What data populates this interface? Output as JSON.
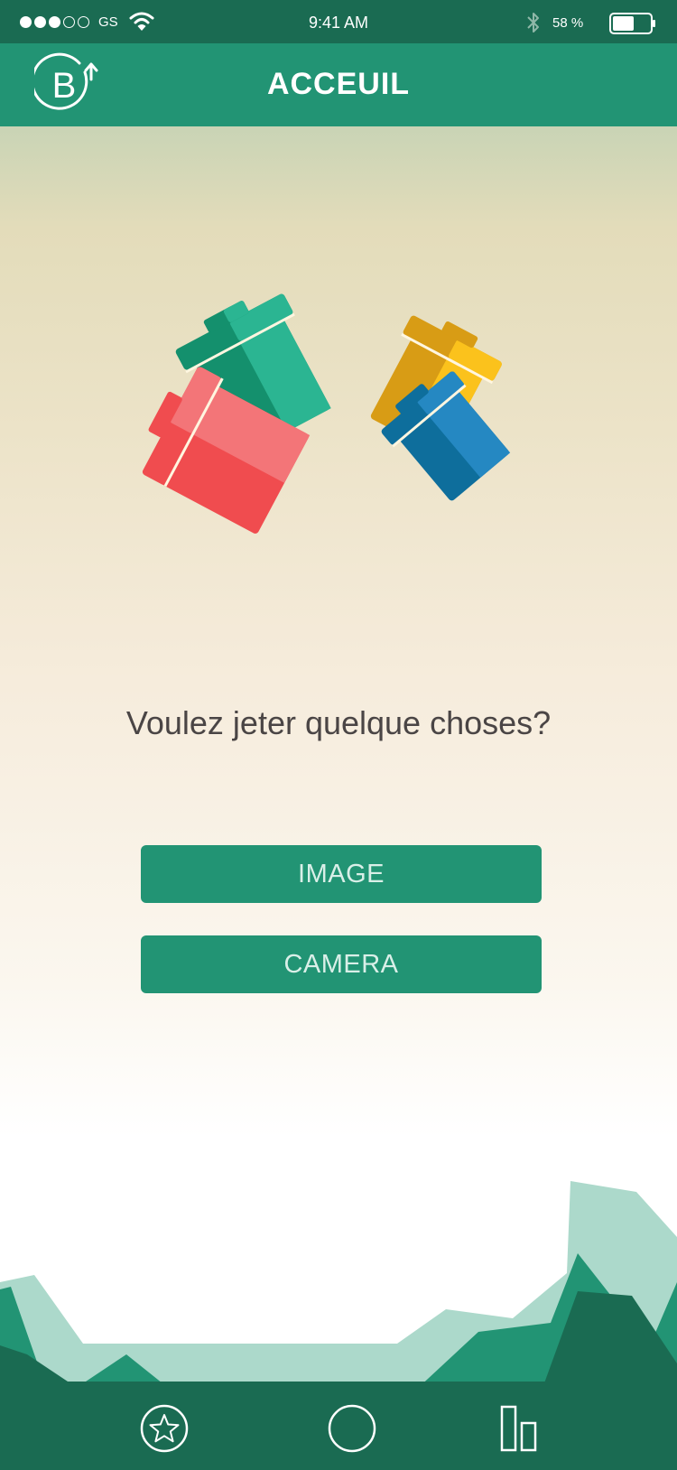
{
  "status_bar": {
    "carrier": "GS",
    "time": "9:41 AM",
    "battery_percent": "58 %",
    "battery_level": 0.58,
    "signal_strength": 3,
    "signal_max": 5,
    "icons": [
      "wifi-icon",
      "bluetooth-icon",
      "battery-icon"
    ]
  },
  "header": {
    "title": "ACCEUIL",
    "logo_icon": "b-recycle-logo-icon"
  },
  "main": {
    "illustration": "colored-trash-bins-illustration",
    "question": "Voulez jeter quelque choses?",
    "buttons": {
      "image": "IMAGE",
      "camera": "CAMERA"
    }
  },
  "bottom_nav": {
    "items": [
      "star-icon",
      "circle-icon",
      "bar-chart-icon"
    ]
  },
  "colors": {
    "status_bar": "#1a6b52",
    "header": "#229474",
    "button": "#229474",
    "button_text": "#d9efe8",
    "question_text": "#4a4545",
    "landscape_light": "#acd9cb",
    "landscape_mid": "#229474",
    "landscape_dark": "#1a6b52"
  }
}
